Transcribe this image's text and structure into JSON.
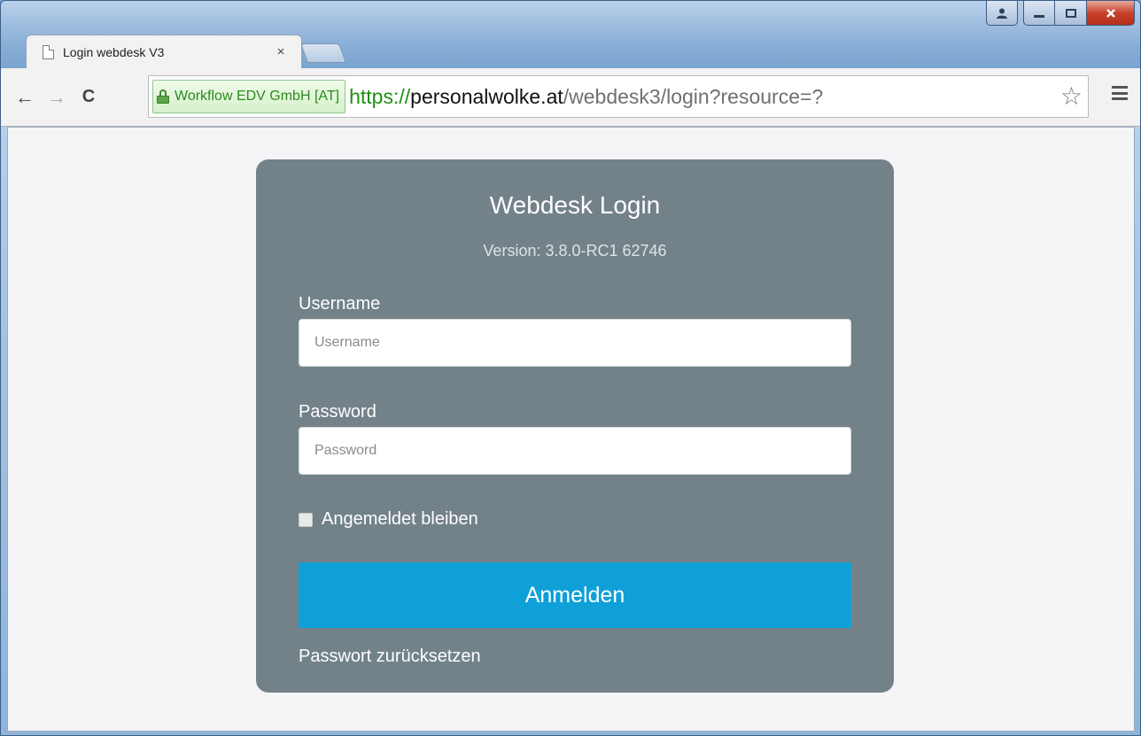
{
  "browser": {
    "tab_title": "Login webdesk V3",
    "tab_close": "×",
    "ev_certificate": "Workflow EDV GmbH [AT]",
    "url": {
      "scheme": "https://",
      "host": "personalwolke.at",
      "path": "/webdesk3/login?resource=?"
    },
    "icons": {
      "back": "←",
      "forward": "→",
      "reload": "C",
      "star": "☆"
    }
  },
  "login": {
    "title": "Webdesk Login",
    "version": "Version: 3.8.0-RC1 62746",
    "username_label": "Username",
    "username_placeholder": "Username",
    "username_value": "",
    "password_label": "Password",
    "password_placeholder": "Password",
    "password_value": "",
    "remember_label": "Angemeldet bleiben",
    "remember_checked": false,
    "submit_label": "Anmelden",
    "reset_link": "Passwort zurücksetzen"
  },
  "colors": {
    "card_bg": "#738289",
    "submit_bg": "#10a0d8",
    "page_bg": "#f5f5f8",
    "ev_green": "#2b8a1f"
  }
}
